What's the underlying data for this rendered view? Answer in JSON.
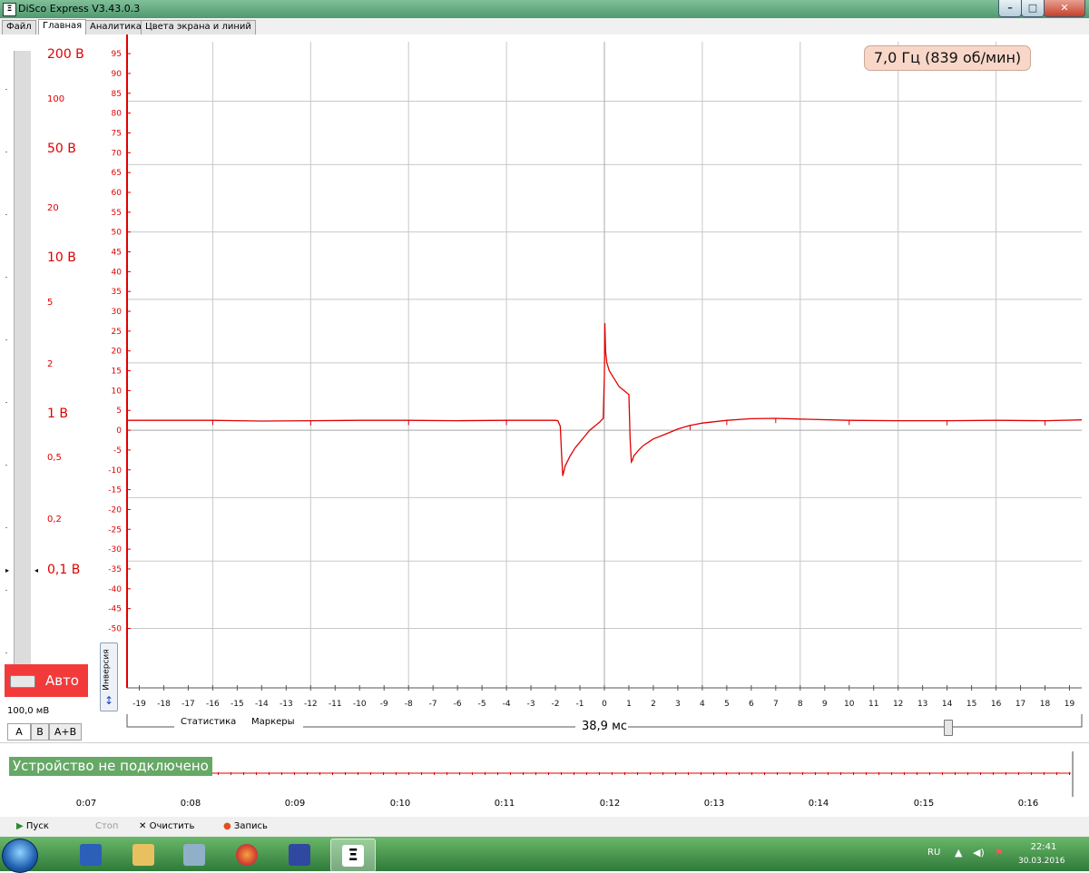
{
  "window": {
    "title": "DiSco Express V3.43.0.3",
    "min_glyph": "–",
    "max_glyph": "□",
    "close_glyph": "✕"
  },
  "tabs": [
    {
      "label": "Файл"
    },
    {
      "label": "Главная"
    },
    {
      "label": "Аналитика"
    },
    {
      "label": "Цвета экрана и линий"
    }
  ],
  "voltage_panel": {
    "scale": [
      {
        "label": "200 В",
        "size": "big"
      },
      {
        "label": "100",
        "size": "small"
      },
      {
        "label": "50 В",
        "size": "big"
      },
      {
        "label": "20",
        "size": "small"
      },
      {
        "label": "10 В",
        "size": "big"
      },
      {
        "label": "5",
        "size": "small"
      },
      {
        "label": "2",
        "size": "small"
      },
      {
        "label": "1 В",
        "size": "big"
      },
      {
        "label": "0,5",
        "size": "small"
      },
      {
        "label": "0,2",
        "size": "small"
      },
      {
        "label": "0,1 В",
        "size": "big"
      }
    ],
    "auto_label": "Авто",
    "range_label": "100,0 мВ",
    "channel_tabs": [
      "A",
      "B",
      "A+B"
    ],
    "active_channel": "A"
  },
  "frequency_readout": "7,0 Гц (839 об/мин)",
  "inversion_label": "Инверсия",
  "chart_data": {
    "type": "line",
    "title": "",
    "xlabel": "",
    "ylabel": "",
    "xlim": [
      -19.5,
      19.5
    ],
    "ylim": [
      -65,
      98
    ],
    "x_ticks": [
      -19,
      -18,
      -17,
      -16,
      -15,
      -14,
      -13,
      -12,
      -11,
      -10,
      -9,
      -8,
      -7,
      -6,
      -5,
      -4,
      -3,
      -2,
      -1,
      0,
      1,
      2,
      3,
      4,
      5,
      6,
      7,
      8,
      9,
      10,
      11,
      12,
      13,
      14,
      15,
      16,
      17,
      18,
      19
    ],
    "y_ticks": [
      95,
      90,
      85,
      80,
      75,
      70,
      65,
      60,
      55,
      50,
      45,
      40,
      35,
      30,
      25,
      20,
      15,
      10,
      5,
      0,
      -5,
      -10,
      -15,
      -20,
      -25,
      -30,
      -35,
      -40,
      -45,
      -50
    ],
    "grid": true,
    "series": [
      {
        "color": "#e00000",
        "x": [
          -19.5,
          -18,
          -16,
          -14,
          -12,
          -10,
          -8,
          -6,
          -4,
          -2,
          -1.9,
          -1.8,
          -1.75,
          -1.7,
          -1.6,
          -1.4,
          -1.2,
          -1,
          -0.8,
          -0.6,
          -0.4,
          -0.2,
          -0.05,
          0,
          0.02,
          0.05,
          0.1,
          0.2,
          0.4,
          0.6,
          0.8,
          1,
          1.05,
          1.1,
          1.15,
          1.2,
          1.4,
          1.6,
          1.8,
          2,
          2.5,
          3,
          3.5,
          4,
          5,
          6,
          7,
          8,
          10,
          12,
          14,
          16,
          18,
          19.5
        ],
        "y": [
          2.5,
          2.5,
          2.5,
          2.3,
          2.4,
          2.5,
          2.5,
          2.4,
          2.5,
          2.5,
          2.4,
          1,
          -6,
          -11.5,
          -9,
          -6.5,
          -4.5,
          -3,
          -1.5,
          0,
          1,
          2,
          3,
          14,
          27,
          20,
          17,
          15,
          13,
          11,
          10,
          9,
          -2,
          -8,
          -7.5,
          -6.5,
          -5,
          -3.8,
          -3,
          -2.2,
          -1,
          0.3,
          1.2,
          1.8,
          2.5,
          2.9,
          3,
          2.8,
          2.5,
          2.4,
          2.4,
          2.5,
          2.4,
          2.6
        ]
      }
    ]
  },
  "chart_controls": {
    "stats_label": "Статистика",
    "markers_label": "Маркеры",
    "timebase": "38,9 мс"
  },
  "overview": {
    "status": "Устройство не подключено",
    "ticks": [
      "0:07",
      "0:08",
      "0:09",
      "0:10",
      "0:11",
      "0:12",
      "0:13",
      "0:14",
      "0:15",
      "0:16"
    ]
  },
  "toolbar": {
    "start": "Пуск",
    "stop": "Стоп",
    "clear": "Очистить",
    "record": "Запись"
  },
  "taskbar": {
    "lang": "RU",
    "time": "22:41",
    "date": "30.03.2016",
    "apps": [
      "word-icon",
      "folder-icon",
      "network-icon",
      "firefox-icon",
      "save-icon",
      "disco-icon"
    ]
  }
}
